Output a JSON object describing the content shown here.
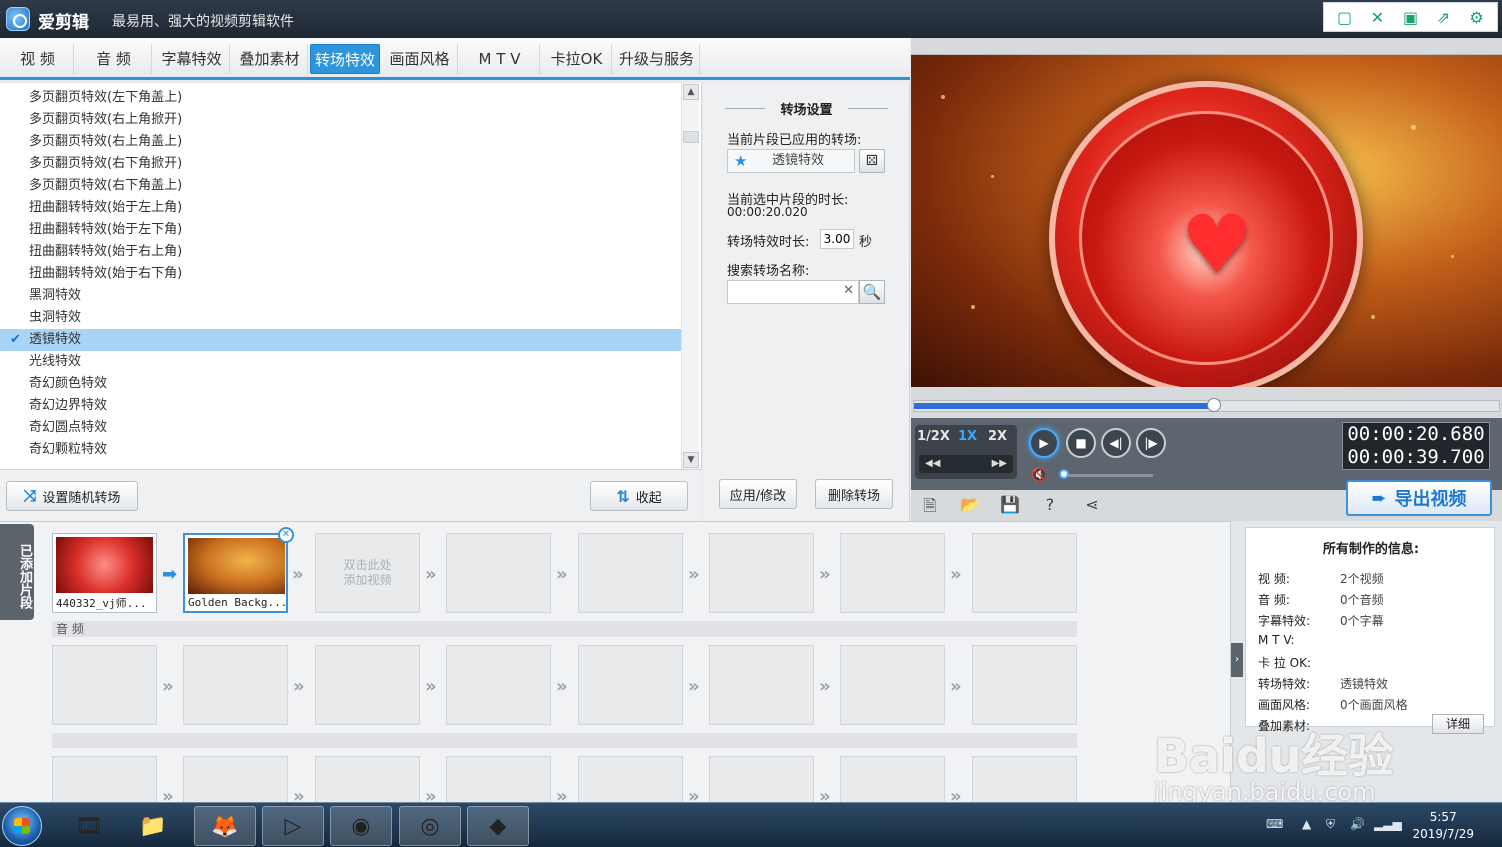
{
  "app": {
    "name": "爱剪辑",
    "slogan": "最易用、强大的视频剪辑软件",
    "window_buttons": [
      "minimize-icon",
      "fullscreen-icon",
      "save-icon",
      "share-icon",
      "settings-icon"
    ]
  },
  "menu": {
    "tabs": [
      "视  频",
      "音  频",
      "字幕特效",
      "叠加素材",
      "转场特效",
      "画面风格",
      "M T V",
      "卡拉OK",
      "升级与服务"
    ],
    "active_index": 4
  },
  "transitions": {
    "items": [
      "多页翻页特效(左下角盖上)",
      "多页翻页特效(右上角掀开)",
      "多页翻页特效(右上角盖上)",
      "多页翻页特效(右下角掀开)",
      "多页翻页特效(右下角盖上)",
      "扭曲翻转特效(始于左上角)",
      "扭曲翻转特效(始于左下角)",
      "扭曲翻转特效(始于右上角)",
      "扭曲翻转特效(始于右下角)",
      "黑洞特效",
      "虫洞特效",
      "透镜特效",
      "光线特效",
      "奇幻颜色特效",
      "奇幻边界特效",
      "奇幻圆点特效",
      "奇幻颗粒特效"
    ],
    "selected_index": 11,
    "random_button": "设置随机转场",
    "collapse_button": "收起"
  },
  "settings": {
    "title": "转场设置",
    "applied_label": "当前片段已应用的转场:",
    "applied_value": "透镜特效",
    "duration_label": "当前选中片段的时长:",
    "duration_value": "00:00:20.020",
    "effect_duration_label": "转场特效时长:",
    "effect_duration_value": "3.00",
    "effect_duration_unit": "秒",
    "search_label": "搜索转场名称:",
    "search_value": "",
    "apply_button": "应用/修改",
    "delete_button": "删除转场"
  },
  "player": {
    "progress": 0.52,
    "speeds": [
      "1/2X",
      "1X",
      "2X"
    ],
    "active_speed": "1X",
    "time_current": "00:00:20.680",
    "time_total": "00:00:39.700",
    "volume_muted_icon": "mute-icon",
    "export_button": "导出视频"
  },
  "timeline": {
    "added_tab": "已添加片段",
    "clips": [
      {
        "caption": "440332_vj师...",
        "thumb": "#d9302a"
      },
      {
        "caption": "Golden Backg...",
        "thumb": "#c9701f"
      }
    ],
    "empty_hint_line1": "双击此处",
    "empty_hint_line2": "添加视频",
    "audio_label": "音 频"
  },
  "info": {
    "title": "所有制作的信息:",
    "rows": [
      {
        "label": "视    频:",
        "value": "2个视频"
      },
      {
        "label": "音    频:",
        "value": "0个音频"
      },
      {
        "label": "字幕特效:",
        "value": "0个字幕"
      },
      {
        "label": "M  T  V:",
        "value": ""
      },
      {
        "label": "卡 拉 OK:",
        "value": ""
      },
      {
        "label": "转场特效:",
        "value": "透镜特效"
      },
      {
        "label": "画面风格:",
        "value": "0个画面风格"
      },
      {
        "label": "叠加素材:",
        "value": ""
      }
    ],
    "detail_button": "详细"
  },
  "watermark": {
    "line1": "Baidu经验",
    "line2": "jingyan.baidu.com"
  },
  "taskbar": {
    "time": "5:57",
    "date": "2019/7/29"
  }
}
